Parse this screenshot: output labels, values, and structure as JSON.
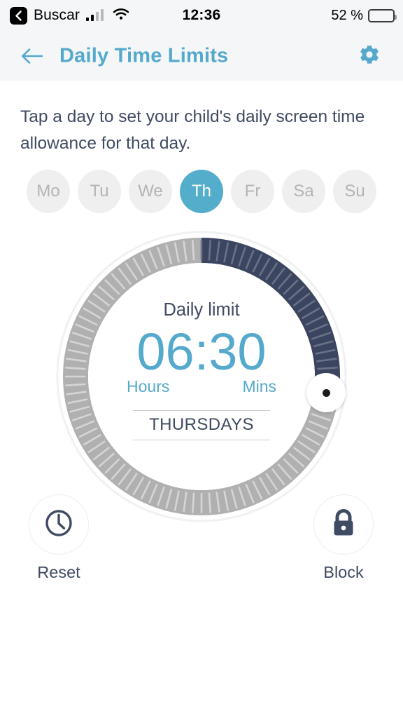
{
  "status_bar": {
    "back_badge_icon": "chevron-left-icon",
    "carrier": "Buscar",
    "signal_icon": "cellular-signal-icon",
    "wifi_icon": "wifi-icon",
    "time": "12:36",
    "battery_percent": "52 %",
    "battery_level": 52,
    "battery_icon": "battery-icon"
  },
  "header": {
    "back_icon": "arrow-left-icon",
    "title": "Daily Time Limits",
    "settings_icon": "gear-icon",
    "accent_color": "#54a9cc",
    "background_color": "#f4f6f7"
  },
  "instructions": {
    "text": "Tap a day to set your child's daily screen time allowance for that day."
  },
  "day_selector": {
    "days": [
      {
        "label": "Mo",
        "selected": false
      },
      {
        "label": "Tu",
        "selected": false
      },
      {
        "label": "We",
        "selected": false
      },
      {
        "label": "Th",
        "selected": true
      },
      {
        "label": "Fr",
        "selected": false
      },
      {
        "label": "Sa",
        "selected": false
      },
      {
        "label": "Su",
        "selected": false
      }
    ],
    "selected_color": "#54aecb",
    "unselected_color": "#efefef",
    "unselected_text_color": "#b4b4b4"
  },
  "dial": {
    "caption": "Daily limit",
    "time_value": "06:30",
    "hours_label": "Hours",
    "mins_label": "Mins",
    "day_label": "THURSDAYS",
    "hours": 6,
    "minutes": 30,
    "max_hours": 24,
    "arc_sweep_degrees": 97.5,
    "active_arc_color": "#3c4560",
    "track_color": "#b0b0b0",
    "tick_color": "#d5d5d5",
    "knob_icon": "dial-knob-handle"
  },
  "actions": {
    "reset": {
      "label": "Reset",
      "icon": "clock-icon"
    },
    "block": {
      "label": "Block",
      "icon": "lock-icon"
    }
  }
}
